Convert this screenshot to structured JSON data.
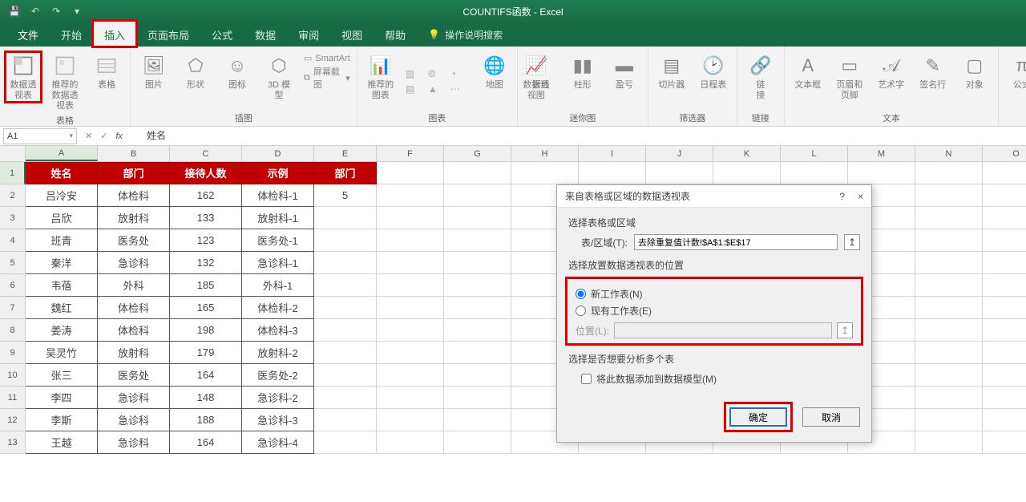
{
  "app_title": "COUNTIFS函数 - Excel",
  "qat": {
    "save": "保存",
    "undo": "撤消",
    "redo": "重做"
  },
  "tabs": {
    "file": "文件",
    "items": [
      "开始",
      "插入",
      "页面布局",
      "公式",
      "数据",
      "审阅",
      "视图",
      "帮助"
    ],
    "active_index": 1,
    "tell_me": "操作说明搜索"
  },
  "ribbon": {
    "groups": [
      {
        "label": "表格",
        "items": [
          {
            "n": "pivot-table",
            "l": "数据透\n视表"
          },
          {
            "n": "recommended-pivot",
            "l": "推荐的\n数据透视表"
          },
          {
            "n": "table",
            "l": "表格"
          }
        ]
      },
      {
        "label": "插图",
        "items": [
          {
            "n": "pictures",
            "l": "图片"
          },
          {
            "n": "shapes",
            "l": "形状"
          },
          {
            "n": "icons",
            "l": "图标"
          },
          {
            "n": "3d-models",
            "l": "3D 模\n型"
          }
        ],
        "side": [
          {
            "n": "smartart",
            "l": "SmartArt"
          },
          {
            "n": "screenshot",
            "l": "屏幕截图"
          }
        ]
      },
      {
        "label": "图表",
        "items": [
          {
            "n": "recommended-charts",
            "l": "推荐的\n图表"
          }
        ],
        "side_grid": true,
        "side_items": [
          {
            "n": "maps",
            "l": "地图"
          },
          {
            "n": "pivot-chart",
            "l": "数据透视图"
          }
        ]
      },
      {
        "label": "迷你图",
        "items": [
          {
            "n": "sparkline-line",
            "l": "折线"
          },
          {
            "n": "sparkline-column",
            "l": "柱形"
          },
          {
            "n": "sparkline-winloss",
            "l": "盈亏"
          }
        ]
      },
      {
        "label": "筛选器",
        "items": [
          {
            "n": "slicer",
            "l": "切片器"
          },
          {
            "n": "timeline",
            "l": "日程表"
          }
        ]
      },
      {
        "label": "链接",
        "items": [
          {
            "n": "link",
            "l": "链\n接"
          }
        ]
      },
      {
        "label": "文本",
        "items": [
          {
            "n": "text-box",
            "l": "文本框"
          },
          {
            "n": "header-footer",
            "l": "页眉和页脚"
          },
          {
            "n": "wordart",
            "l": "艺术字"
          },
          {
            "n": "signature",
            "l": "签名行"
          },
          {
            "n": "object",
            "l": "对象"
          }
        ]
      },
      {
        "label": "",
        "items": [
          {
            "n": "equation",
            "l": "公式"
          }
        ]
      }
    ]
  },
  "formula_bar": {
    "name_box": "A1",
    "formula": "姓名"
  },
  "columns": [
    "A",
    "B",
    "C",
    "D",
    "E",
    "F",
    "G",
    "H",
    "I",
    "J",
    "K",
    "L",
    "M",
    "N",
    "O"
  ],
  "sheet": {
    "headers": [
      "姓名",
      "部门",
      "接待人数",
      "示例",
      "部门"
    ],
    "rows": [
      [
        "吕冷安",
        "体检科",
        "162",
        "体检科-1",
        "5"
      ],
      [
        "吕欣",
        "放射科",
        "133",
        "放射科-1",
        ""
      ],
      [
        "班青",
        "医务处",
        "123",
        "医务处-1",
        ""
      ],
      [
        "秦洋",
        "急诊科",
        "132",
        "急诊科-1",
        ""
      ],
      [
        "韦蓓",
        "外科",
        "185",
        "外科-1",
        ""
      ],
      [
        "魏红",
        "体检科",
        "165",
        "体检科-2",
        ""
      ],
      [
        "姜涛",
        "体检科",
        "198",
        "体检科-3",
        ""
      ],
      [
        "吴灵竹",
        "放射科",
        "179",
        "放射科-2",
        ""
      ],
      [
        "张三",
        "医务处",
        "164",
        "医务处-2",
        ""
      ],
      [
        "李四",
        "急诊科",
        "148",
        "急诊科-2",
        ""
      ],
      [
        "李斯",
        "急诊科",
        "188",
        "急诊科-3",
        ""
      ],
      [
        "王越",
        "急诊科",
        "164",
        "急诊科-4",
        ""
      ]
    ]
  },
  "dialog": {
    "title": "来自表格或区域的数据透视表",
    "help": "?",
    "close": "×",
    "sec1": "选择表格或区域",
    "range_label": "表/区域(T):",
    "range_value": "去除重复值计数!$A$1:$E$17",
    "sec2": "选择放置数据透视表的位置",
    "new_sheet": "新工作表(N)",
    "existing_sheet": "现有工作表(E)",
    "location_label": "位置(L):",
    "location_value": "",
    "sec3": "选择是否想要分析多个表",
    "add_model": "将此数据添加到数据模型(M)",
    "ok": "确定",
    "cancel": "取消"
  }
}
